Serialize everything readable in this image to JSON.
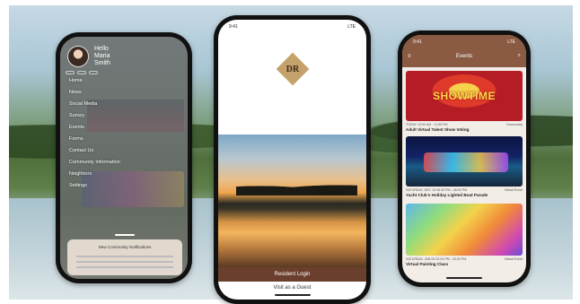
{
  "left_phone": {
    "profile": {
      "greeting": "Hello",
      "first_name": "Maria",
      "last_name": "Smith"
    },
    "pills": [
      "",
      "",
      ""
    ],
    "menu": [
      "Home",
      "News",
      "Social Media",
      "Survey",
      "Events",
      "Forms",
      "Contact Us",
      "Community Information",
      "Neighbors",
      "Settings"
    ],
    "sheet_title": "New Community Notifications"
  },
  "middle_phone": {
    "status": {
      "time": "9:41",
      "signal": "LTE"
    },
    "logo_text": "DR",
    "login_label": "Resident Login",
    "guest_label": "Visit as a Guest"
  },
  "right_phone": {
    "status": {
      "time": "9:41",
      "signal": "LTE"
    },
    "header_title": "Events",
    "events": [
      {
        "image_word": "SHOWTIME",
        "date": "TODAY 10:00 AM - 11:55 PM",
        "location": "Community",
        "title": "Adult Virtual Talent Show Voting"
      },
      {
        "date": "SATURDAY, DEC 19 06:30 PM - 08:00 PM",
        "location": "Virtual Event",
        "title": "Yacht Club's Holiday Lighted Boat Parade"
      },
      {
        "date": "SATURDAY, JAN 09 02:00 PM - 03:30 PM",
        "location": "Virtual Event",
        "title": "Virtual Painting Class"
      }
    ]
  }
}
